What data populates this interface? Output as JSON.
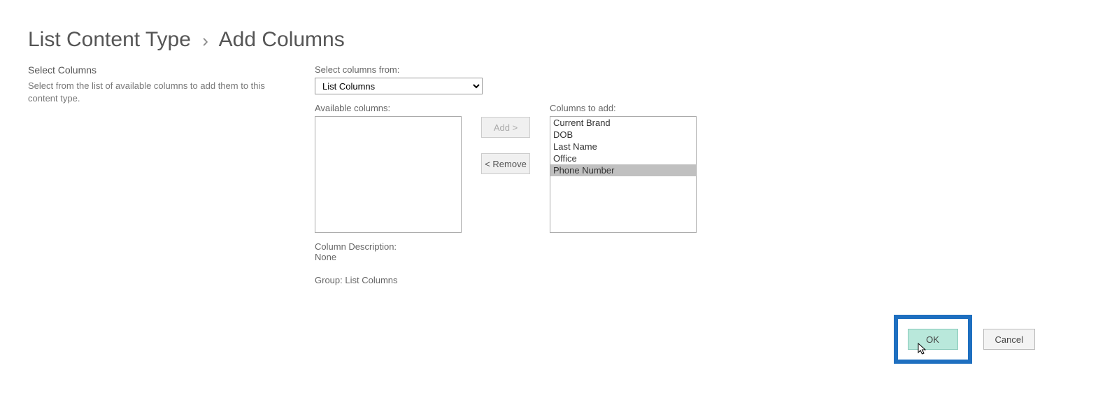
{
  "breadcrumb": {
    "parent": "List Content Type",
    "current": "Add Columns"
  },
  "section": {
    "title": "Select Columns",
    "description": "Select from the list of available columns to add them to this content type."
  },
  "select_from": {
    "label": "Select columns from:",
    "value": "List Columns"
  },
  "available": {
    "label": "Available columns:",
    "items": []
  },
  "buttons": {
    "add": "Add >",
    "remove": "< Remove",
    "ok": "OK",
    "cancel": "Cancel"
  },
  "to_add": {
    "label": "Columns to add:",
    "items": [
      {
        "label": "Current Brand",
        "selected": false
      },
      {
        "label": "DOB",
        "selected": false
      },
      {
        "label": "Last Name",
        "selected": false
      },
      {
        "label": "Office",
        "selected": false
      },
      {
        "label": "Phone Number",
        "selected": true
      }
    ]
  },
  "description": {
    "label": "Column Description:",
    "value": "None"
  },
  "group": {
    "label": "Group:",
    "value": "List Columns"
  }
}
